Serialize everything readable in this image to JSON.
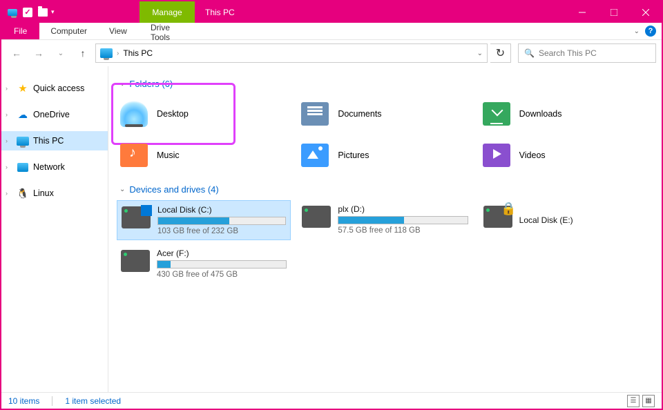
{
  "window": {
    "title": "This PC",
    "context_tab_group": "Manage",
    "context_tab": "Drive Tools"
  },
  "ribbon": {
    "file": "File",
    "tabs": [
      "Computer",
      "View"
    ]
  },
  "nav": {
    "location": "This PC",
    "search_placeholder": "Search This PC"
  },
  "sidebar": {
    "items": [
      {
        "label": "Quick access",
        "icon": "star",
        "expandable": true
      },
      {
        "label": "OneDrive",
        "icon": "cloud",
        "expandable": true
      },
      {
        "label": "This PC",
        "icon": "pc",
        "expandable": true,
        "selected": true
      },
      {
        "label": "Network",
        "icon": "network",
        "expandable": true
      },
      {
        "label": "Linux",
        "icon": "linux",
        "expandable": true
      }
    ]
  },
  "groups": {
    "folders": {
      "header": "Folders (6)",
      "items": [
        {
          "label": "Desktop",
          "icon": "desktop"
        },
        {
          "label": "Documents",
          "icon": "docs"
        },
        {
          "label": "Downloads",
          "icon": "downloads"
        },
        {
          "label": "Music",
          "icon": "music"
        },
        {
          "label": "Pictures",
          "icon": "pictures"
        },
        {
          "label": "Videos",
          "icon": "videos"
        }
      ]
    },
    "drives": {
      "header": "Devices and drives (4)",
      "items": [
        {
          "label": "Local Disk (C:)",
          "free": "103 GB free of 232 GB",
          "pct": 56,
          "icon": "win",
          "selected": true
        },
        {
          "label": "plx (D:)",
          "free": "57.5 GB free of 118 GB",
          "pct": 51,
          "icon": "plain"
        },
        {
          "label": "Local Disk (E:)",
          "free": "",
          "pct": 0,
          "icon": "lock",
          "nobar": true
        },
        {
          "label": "Acer (F:)",
          "free": "430 GB free of 475 GB",
          "pct": 10,
          "icon": "plain"
        }
      ]
    }
  },
  "status": {
    "items": "10 items",
    "selected": "1 item selected"
  }
}
